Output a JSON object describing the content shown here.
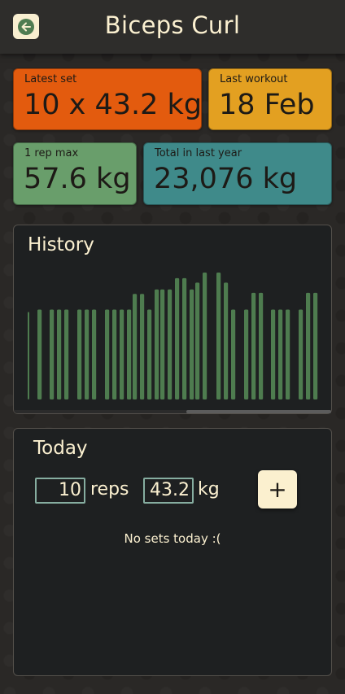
{
  "header": {
    "title": "Biceps Curl",
    "back_icon": "arrow-left-icon"
  },
  "stats": {
    "latest_set": {
      "label": "Latest set",
      "value": "10 x 43.2 kg",
      "color": "#e35b0e"
    },
    "last_workout": {
      "label": "Last workout",
      "value": "18 Feb",
      "color": "#e3a021"
    },
    "one_rep_max": {
      "label": "1 rep max",
      "value": "57.6 kg",
      "color": "#699e6b"
    },
    "total_last_year": {
      "label": "Total in last year",
      "value": "23,076 kg",
      "color": "#3f8a8a"
    }
  },
  "history": {
    "title": "History",
    "bar_color": "#4e7c4f"
  },
  "chart_data": {
    "type": "bar",
    "values": [
      0.78,
      0.8,
      0.8,
      0.8,
      0.8,
      0.8,
      0.8,
      0.8,
      0.8,
      0.8,
      0.8,
      0.8,
      0.94,
      0.94,
      0.8,
      0.98,
      0.98,
      0.98,
      1.08,
      1.08,
      0.98,
      1.04,
      1.13,
      1.13,
      1.04,
      0.8,
      0.8,
      0.95,
      0.95,
      0.8,
      0.8,
      0.8,
      0.8,
      0.95,
      0.95
    ]
  },
  "today": {
    "title": "Today",
    "reps_value": "10",
    "reps_unit": "reps",
    "weight_value": "43.2",
    "weight_unit": "kg",
    "add_label": "+",
    "empty_message": "No sets today :("
  }
}
